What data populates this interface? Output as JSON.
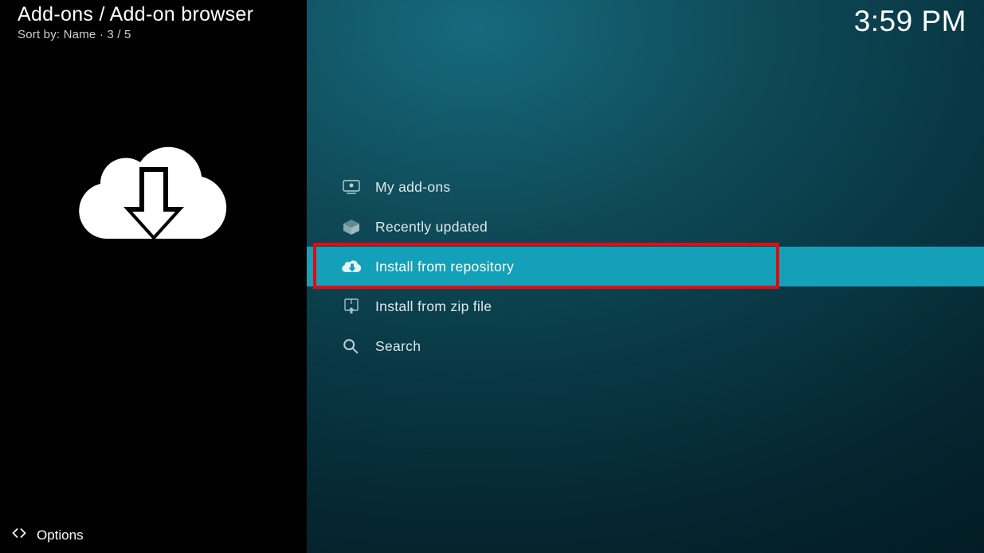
{
  "header": {
    "breadcrumb": "Add-ons / Add-on browser",
    "sort_line": "Sort by: Name  ·  3 / 5"
  },
  "clock": "3:59 PM",
  "menu": {
    "items": [
      {
        "label": "My add-ons",
        "icon": "monitor-icon",
        "selected": false
      },
      {
        "label": "Recently updated",
        "icon": "box-icon",
        "selected": false
      },
      {
        "label": "Install from repository",
        "icon": "cloud-download-small-icon",
        "selected": true
      },
      {
        "label": "Install from zip file",
        "icon": "zip-download-icon",
        "selected": false
      },
      {
        "label": "Search",
        "icon": "search-icon",
        "selected": false
      }
    ]
  },
  "footer": {
    "options_label": "Options"
  }
}
